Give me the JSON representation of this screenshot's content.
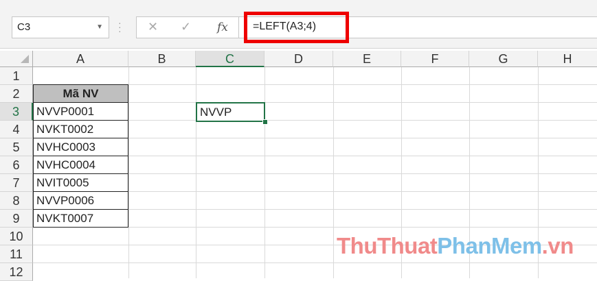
{
  "name_box": {
    "value": "C3"
  },
  "formula_bar": {
    "fx_label": "fx",
    "cancel": "✕",
    "enter": "✓",
    "formula": "=LEFT(A3;4)"
  },
  "columns": [
    "A",
    "B",
    "C",
    "D",
    "E",
    "F",
    "G",
    "H"
  ],
  "selected_column": "C",
  "rows": [
    "1",
    "2",
    "3",
    "4",
    "5",
    "6",
    "7",
    "8",
    "9",
    "10",
    "11",
    "12"
  ],
  "selected_row": "3",
  "table": {
    "header": "Mã NV",
    "values": [
      "NVVP0001",
      "NVKT0002",
      "NVHC0003",
      "NVHC0004",
      "NVIT0005",
      "NVVP0006",
      "NVKT0007"
    ]
  },
  "active_cell": {
    "ref": "C3",
    "value": "NVVP"
  },
  "watermark": {
    "part1": "ThuThuat",
    "part2": "PhanMem",
    "part3": ".vn",
    "colors": {
      "part1": "#f08a8a",
      "part2": "#7ec0e8",
      "part3": "#f08a8a"
    }
  },
  "colors": {
    "accent": "#217346",
    "highlight": "#e00000",
    "header_fill": "#bfbfbf"
  },
  "icons": [
    "dropdown-arrow-icon",
    "cancel-icon",
    "enter-icon",
    "fx-icon",
    "select-all-icon"
  ]
}
